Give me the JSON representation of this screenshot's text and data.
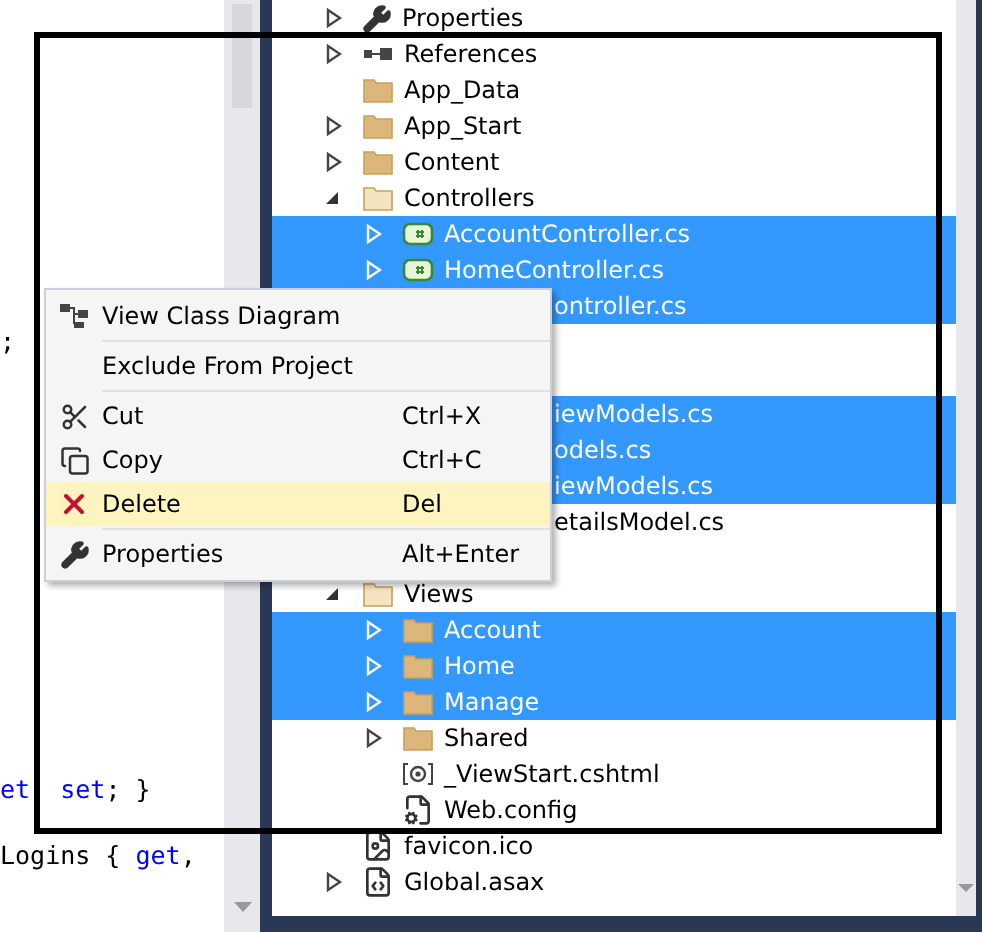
{
  "editor": {
    "lines": [
      {
        "tokens": [
          {
            "text": ";",
            "kind": "plain"
          }
        ]
      },
      {
        "tokens": [
          {
            "text": "et",
            "kind": "keyword"
          },
          {
            "text": "  set",
            "kind": "keyword"
          },
          {
            "text": "; }",
            "kind": "plain"
          }
        ]
      },
      {
        "tokens": [
          {
            "text": "Logins { ",
            "kind": "plain"
          },
          {
            "text": "get",
            "kind": "keyword"
          },
          {
            "text": ",",
            "kind": "plain"
          }
        ]
      }
    ]
  },
  "solution_explorer": {
    "tree": [
      {
        "label": "Properties",
        "kind": "wrench",
        "expanded": false,
        "selected": false
      },
      {
        "label": "References",
        "kind": "references",
        "expanded": false,
        "selected": false
      },
      {
        "label": "App_Data",
        "kind": "folder",
        "selected": false
      },
      {
        "label": "App_Start",
        "kind": "folder",
        "expanded": false,
        "selected": false
      },
      {
        "label": "Content",
        "kind": "folder",
        "expanded": false,
        "selected": false
      },
      {
        "label": "Controllers",
        "kind": "folder",
        "expanded": true,
        "selected": false,
        "children": [
          {
            "label": "AccountController.cs",
            "kind": "csharp",
            "expanded": false,
            "selected": true
          },
          {
            "label": "HomeController.cs",
            "kind": "csharp",
            "expanded": false,
            "selected": true
          },
          {
            "label": "ontroller.cs",
            "kind": "clipped",
            "selected": true
          }
        ]
      },
      {
        "kind": "covered"
      },
      {
        "kind": "covered",
        "children": [
          {
            "label": "iewModels.cs",
            "kind": "clipped",
            "selected": true
          },
          {
            "label": "odels.cs",
            "kind": "clipped",
            "selected": true
          },
          {
            "label": "iewModels.cs",
            "kind": "clipped",
            "selected": true
          },
          {
            "label": "etailsModel.cs",
            "kind": "clipped",
            "selected": false
          }
        ]
      },
      {
        "kind": "covered"
      },
      {
        "label": "Views",
        "kind": "folder",
        "expanded": true,
        "selected": false,
        "children": [
          {
            "label": "Account",
            "kind": "folder",
            "expanded": false,
            "selected": true
          },
          {
            "label": "Home",
            "kind": "folder",
            "expanded": false,
            "selected": true
          },
          {
            "label": "Manage",
            "kind": "folder",
            "expanded": false,
            "selected": true
          },
          {
            "label": "Shared",
            "kind": "folder",
            "expanded": false,
            "selected": false
          },
          {
            "label": "_ViewStart.cshtml",
            "kind": "razor",
            "selected": false
          },
          {
            "label": "Web.config",
            "kind": "config",
            "selected": false
          }
        ]
      },
      {
        "label": "favicon.ico",
        "kind": "image",
        "selected": false
      },
      {
        "label": "Global.asax",
        "kind": "asax",
        "expanded": false,
        "selected": false
      }
    ]
  },
  "context_menu": {
    "items": [
      {
        "kind": "diagram",
        "label": "View Class Diagram",
        "selected": false
      },
      {
        "kind": "separator"
      },
      {
        "kind": "plain",
        "label": "Exclude From Project",
        "selected": false
      },
      {
        "kind": "separator"
      },
      {
        "kind": "cut",
        "label": "Cut",
        "shortcut": "Ctrl+X",
        "selected": false
      },
      {
        "kind": "copy",
        "label": "Copy",
        "shortcut": "Ctrl+C",
        "selected": false
      },
      {
        "kind": "delete",
        "label": "Delete",
        "shortcut": "Del",
        "selected": true
      },
      {
        "kind": "separator"
      },
      {
        "kind": "properties",
        "label": "Properties",
        "shortcut": "Alt+Enter",
        "selected": false
      }
    ]
  }
}
